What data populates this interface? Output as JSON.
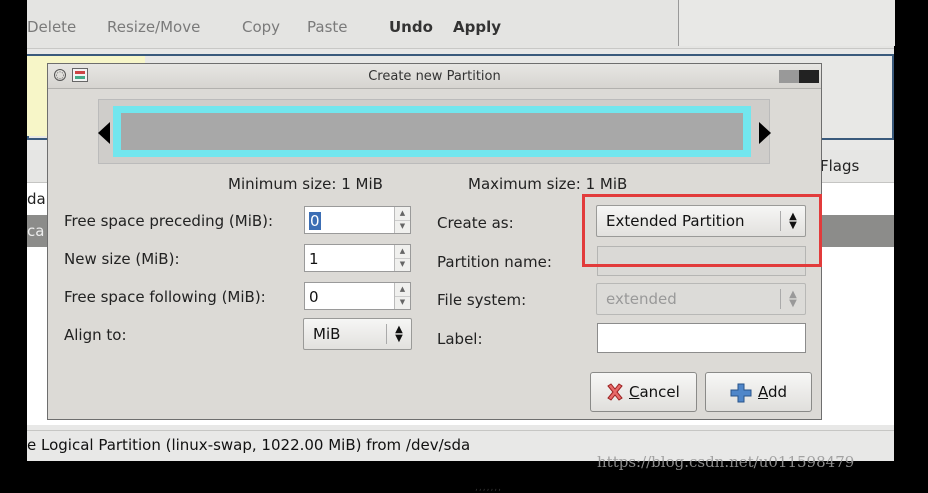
{
  "toolbar": {
    "items": [
      "Delete",
      "Resize/Move",
      "Copy",
      "Paste",
      "Undo",
      "Apply"
    ]
  },
  "background": {
    "column_flags": "Flags",
    "row1_text": "da",
    "row2_text": "ca",
    "status_text": "e Logical Partition (linux-swap, 1022.00 MiB) from /dev/sda"
  },
  "watermark": "https://blog.csdn.net/u011598479",
  "dialog": {
    "title": "Create new Partition",
    "min_size": "Minimum size: 1 MiB",
    "max_size": "Maximum size: 1 MiB",
    "left": {
      "free_before_label": "Free space preceding (MiB):",
      "free_before_value": "0",
      "new_size_label": "New size (MiB):",
      "new_size_value": "1",
      "free_after_label": "Free space following (MiB):",
      "free_after_value": "0",
      "align_label": "Align to:",
      "align_value": "MiB"
    },
    "right": {
      "create_as_label": "Create as:",
      "create_as_value": "Extended Partition",
      "partition_name_label": "Partition name:",
      "partition_name_value": "",
      "file_system_label": "File system:",
      "file_system_value": "extended",
      "label_label": "Label:",
      "label_value": ""
    },
    "buttons": {
      "cancel": "Cancel",
      "add": "Add"
    }
  },
  "colors": {
    "partition_outline": "#72e6ee",
    "partition_fill": "#a8a8a8",
    "highlight": "#e23b3b"
  }
}
